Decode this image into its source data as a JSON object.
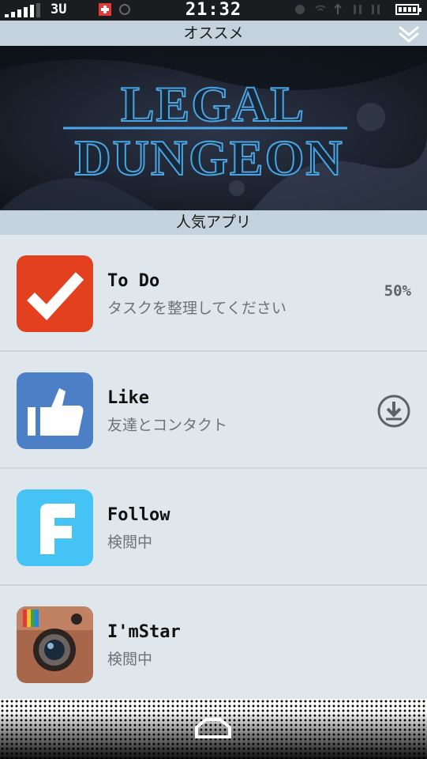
{
  "status_bar": {
    "carrier": "3U",
    "time": "21:32"
  },
  "header": {
    "title": "オススメ"
  },
  "banner": {
    "title_line1": "LEGAL",
    "title_line2": "DUNGEON"
  },
  "popular": {
    "title": "人気アプリ"
  },
  "apps": [
    {
      "name": "To Do",
      "desc": "タスクを整理してください",
      "status": "50%"
    },
    {
      "name": "Like",
      "desc": "友達とコンタクト",
      "status": ""
    },
    {
      "name": "Follow",
      "desc": "検閲中",
      "status": ""
    },
    {
      "name": "I'mStar",
      "desc": "検閲中",
      "status": ""
    }
  ],
  "colors": {
    "accent": "#c3d2dc",
    "todo": "#e2401f",
    "like": "#4d7fc7",
    "follow": "#46c3f5",
    "instagram": "#a8664a"
  }
}
